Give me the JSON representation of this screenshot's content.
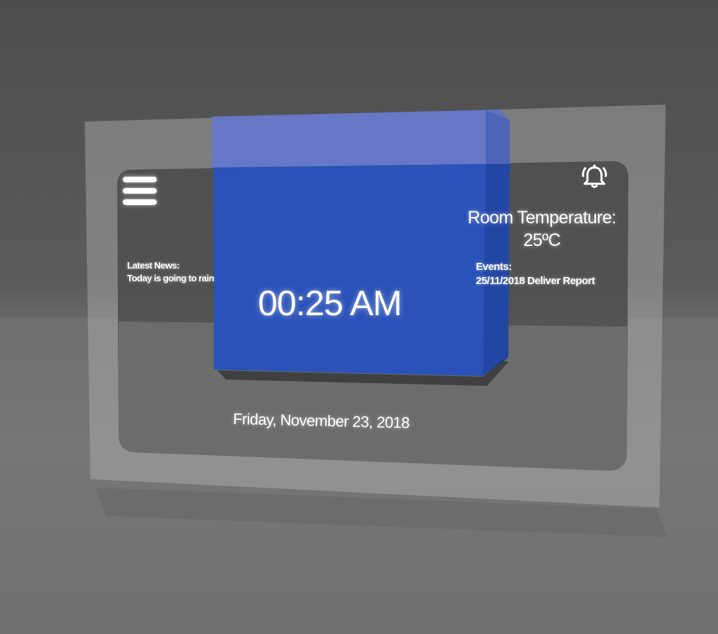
{
  "header": {
    "menu_icon": "hamburger-menu-icon",
    "alarm_icon": "alarm-bell-icon"
  },
  "news": {
    "heading": "Latest News:",
    "text": "Today is going to rain"
  },
  "temperature": {
    "label": "Room Temperature:",
    "value": "25ºC"
  },
  "events": {
    "heading": "Events:",
    "item": "25/11/2018 Deliver Report"
  },
  "clock": {
    "time": "00:25 AM",
    "date": "Friday, November 23, 2018"
  },
  "colors": {
    "accent_blue": "#2a52b8",
    "screen_dark": "#4a4a4a",
    "text": "#ffffff"
  }
}
